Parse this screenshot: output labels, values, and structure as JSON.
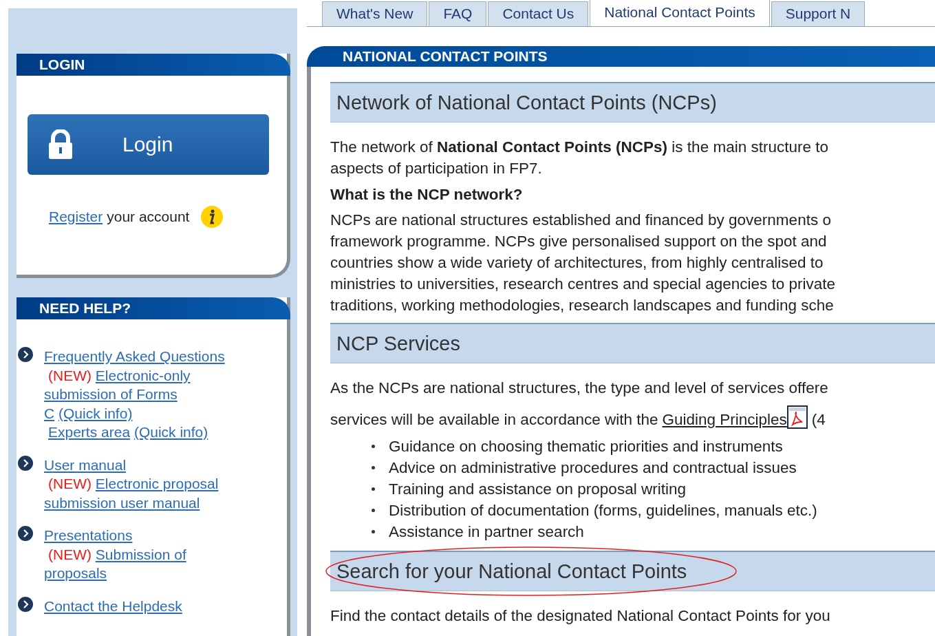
{
  "tabs": [
    {
      "label": "What's New",
      "selected": false
    },
    {
      "label": "FAQ",
      "selected": false
    },
    {
      "label": "Contact Us",
      "selected": false
    },
    {
      "label": "National Contact Points",
      "selected": true
    },
    {
      "label": "Support N",
      "selected": false
    }
  ],
  "login_panel": {
    "title": "LOGIN",
    "button": "Login",
    "register_link": "Register",
    "register_text": "your account"
  },
  "help_panel": {
    "title": "NEED HELP?",
    "items": [
      {
        "lines": [
          {
            "indent": false,
            "segs": [
              {
                "kind": "link",
                "text": "Frequently Asked Questions"
              }
            ]
          },
          {
            "indent": true,
            "segs": [
              {
                "kind": "new",
                "text": "(NEW)"
              },
              {
                "kind": "link",
                "text": "Electronic-only"
              }
            ]
          },
          {
            "indent": false,
            "segs": [
              {
                "kind": "link",
                "text": "submission of Forms"
              }
            ]
          },
          {
            "indent": false,
            "segs": [
              {
                "kind": "link",
                "text": "C"
              },
              {
                "kind": "link",
                "text": "(Quick info)"
              }
            ]
          },
          {
            "indent": true,
            "segs": [
              {
                "kind": "link",
                "text": "Experts area"
              },
              {
                "kind": "link",
                "text": "(Quick info)"
              }
            ]
          }
        ]
      },
      {
        "lines": [
          {
            "indent": false,
            "segs": [
              {
                "kind": "link",
                "text": "User manual"
              }
            ]
          },
          {
            "indent": true,
            "segs": [
              {
                "kind": "new",
                "text": "(NEW)"
              },
              {
                "kind": "link",
                "text": "Electronic proposal"
              }
            ]
          },
          {
            "indent": false,
            "segs": [
              {
                "kind": "link",
                "text": "submission user manual"
              }
            ]
          }
        ]
      },
      {
        "lines": [
          {
            "indent": false,
            "segs": [
              {
                "kind": "link",
                "text": "Presentations"
              }
            ]
          },
          {
            "indent": true,
            "segs": [
              {
                "kind": "new",
                "text": "(NEW)"
              },
              {
                "kind": "link",
                "text": "Submission of"
              }
            ]
          },
          {
            "indent": false,
            "segs": [
              {
                "kind": "link",
                "text": "proposals"
              }
            ]
          }
        ]
      },
      {
        "lines": [
          {
            "indent": false,
            "segs": [
              {
                "kind": "link",
                "text": "Contact the Helpdesk"
              }
            ]
          }
        ]
      }
    ]
  },
  "main_panel": {
    "title": "NATIONAL CONTACT POINTS",
    "sections": [
      {
        "heading": "Network of National Contact Points (NCPs)",
        "blocks": [
          {
            "kind": "lines",
            "lines": [
              "The network of **National Contact Points (NCPs)** is the main structure to",
              "aspects of participation in FP7."
            ]
          },
          {
            "kind": "subheading",
            "text": "What is the NCP network?"
          },
          {
            "kind": "lines",
            "lines": [
              "NCPs are national structures established and financed by governments o",
              "framework programme. NCPs give personalised support on the spot and",
              "countries show a wide variety of architectures, from highly centralised to",
              "ministries to universities, research centres and special agencies to private",
              "traditions, working methodologies, research landscapes and funding sche"
            ]
          }
        ]
      },
      {
        "heading": "NCP Services",
        "blocks": [
          {
            "kind": "lines",
            "lines": [
              "As the NCPs are national structures, the type and level of services offere"
            ]
          },
          {
            "kind": "linkline",
            "before": "services will be available in accordance with the",
            "link": "Guiding Principles",
            "after": "(4"
          },
          {
            "kind": "bullets",
            "items": [
              "Guidance on choosing thematic priorities and instruments",
              "Advice on administrative procedures and contractual issues",
              "Training and assistance on proposal writing",
              "Distribution of documentation (forms, guidelines, manuals etc.)",
              "Assistance in partner search"
            ]
          }
        ]
      },
      {
        "heading": "Search for your National Contact Points",
        "circled": true,
        "blocks": [
          {
            "kind": "lines",
            "lines": [
              "Find the contact details of the designated National Contact Points for you"
            ]
          }
        ]
      }
    ]
  }
}
